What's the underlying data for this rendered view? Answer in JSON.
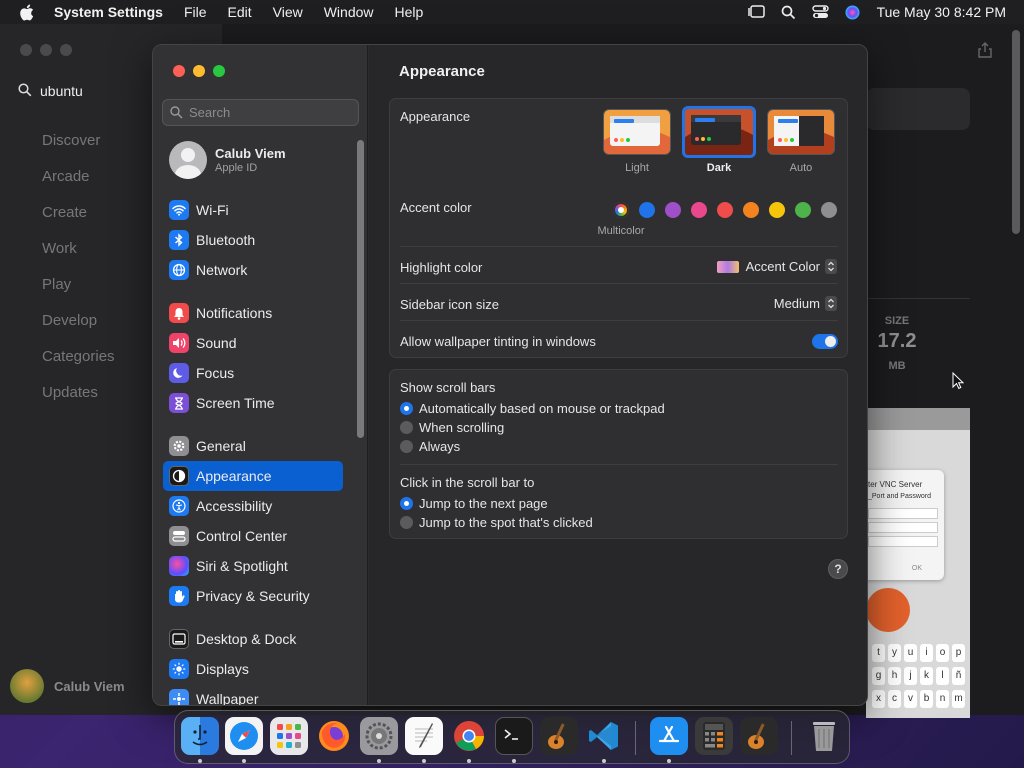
{
  "menubar": {
    "app_name": "System Settings",
    "menus": [
      "File",
      "Edit",
      "View",
      "Window",
      "Help"
    ],
    "clock": "Tue May 30  8:42 PM"
  },
  "background_app": {
    "search_value": "ubuntu",
    "nav": [
      "Discover",
      "Arcade",
      "Create",
      "Work",
      "Play",
      "Develop",
      "Categories",
      "Updates"
    ],
    "user_name": "Calub Viem",
    "size_label": "SIZE",
    "size_value": "17.2",
    "size_unit": "MB",
    "dialog_title": "ter VNC Server",
    "dialog_sub": "_Port and Password",
    "dialog_ok": "OK",
    "keys_row1": [
      "t",
      "y",
      "u",
      "i",
      "o",
      "p"
    ],
    "keys_row2": [
      "g",
      "h",
      "j",
      "k",
      "l",
      "ñ"
    ],
    "keys_row3": [
      "x",
      "c",
      "v",
      "b",
      "n",
      "m"
    ]
  },
  "settings": {
    "search_placeholder": "Search",
    "account": {
      "name": "Calub Viem",
      "sub": "Apple ID"
    },
    "sidebar": [
      {
        "label": "Wi-Fi",
        "icon": "wifi-icon"
      },
      {
        "label": "Bluetooth",
        "icon": "bluetooth-icon"
      },
      {
        "label": "Network",
        "icon": "globe-icon"
      },
      {
        "label": "Notifications",
        "icon": "bell-icon"
      },
      {
        "label": "Sound",
        "icon": "speaker-icon"
      },
      {
        "label": "Focus",
        "icon": "moon-icon"
      },
      {
        "label": "Screen Time",
        "icon": "hourglass-icon"
      },
      {
        "label": "General",
        "icon": "gear-icon"
      },
      {
        "label": "Appearance",
        "icon": "appearance-icon"
      },
      {
        "label": "Accessibility",
        "icon": "accessibility-icon"
      },
      {
        "label": "Control Center",
        "icon": "control-center-icon"
      },
      {
        "label": "Siri & Spotlight",
        "icon": "siri-icon"
      },
      {
        "label": "Privacy & Security",
        "icon": "hand-icon"
      },
      {
        "label": "Desktop & Dock",
        "icon": "dock-icon"
      },
      {
        "label": "Displays",
        "icon": "sun-icon"
      },
      {
        "label": "Wallpaper",
        "icon": "wallpaper-icon"
      }
    ],
    "selected": "Appearance",
    "title": "Appearance",
    "appearance_label": "Appearance",
    "appearance_options": [
      "Light",
      "Dark",
      "Auto"
    ],
    "appearance_selected": "Dark",
    "accent_label": "Accent color",
    "accent_caption": "Multicolor",
    "accent_colors": [
      "#f0436a",
      "#1f74ea",
      "#9f4fc8",
      "#e9488d",
      "#ef4c4c",
      "#f2831f",
      "#f5c50c",
      "#4db34a",
      "#8e8e93"
    ],
    "highlight_label": "Highlight color",
    "highlight_value": "Accent Color",
    "icon_size_label": "Sidebar icon size",
    "icon_size_value": "Medium",
    "tinting_label": "Allow wallpaper tinting in windows",
    "tinting_on": true,
    "scrollbars_label": "Show scroll bars",
    "scrollbars_options": [
      "Automatically based on mouse or trackpad",
      "When scrolling",
      "Always"
    ],
    "click_label": "Click in the scroll bar to",
    "click_options": [
      "Jump to the next page",
      "Jump to the spot that's clicked"
    ],
    "help": "?"
  },
  "dock": [
    "Finder",
    "Safari",
    "Launchpad",
    "Firefox",
    "System Settings",
    "TextEdit",
    "Chrome",
    "Terminal",
    "GarageBand",
    "Visual Studio Code",
    "App Store",
    "Calculator",
    "GarageBand",
    "Trash"
  ]
}
